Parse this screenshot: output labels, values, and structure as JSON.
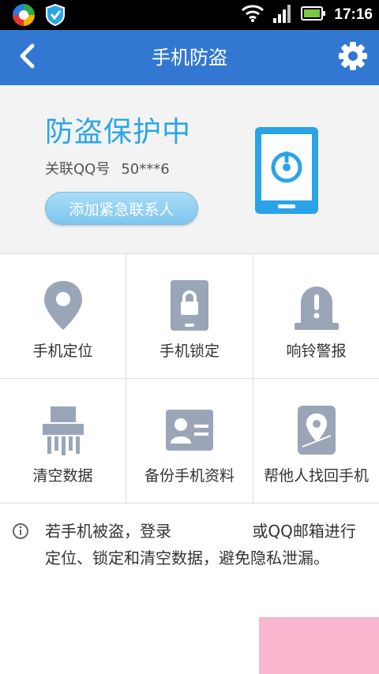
{
  "status_bar": {
    "time": "17:16",
    "icons": [
      "app-logo-icon",
      "shield-icon",
      "wifi-icon",
      "signal-icon",
      "battery-icon"
    ]
  },
  "header": {
    "title": "手机防盗",
    "back_icon": "chevron-left-icon",
    "settings_icon": "gear-icon"
  },
  "protection": {
    "status_title": "防盗保护中",
    "qq_label": "关联QQ号",
    "qq_number": "50***6",
    "add_contact_label": "添加紧急联系人"
  },
  "features": [
    {
      "label": "手机定位",
      "icon": "location-pin-icon"
    },
    {
      "label": "手机锁定",
      "icon": "lock-phone-icon"
    },
    {
      "label": "响铃警报",
      "icon": "alarm-bell-icon"
    },
    {
      "label": "清空数据",
      "icon": "shredder-icon"
    },
    {
      "label": "备份手机资料",
      "icon": "contact-card-icon"
    },
    {
      "label": "帮他人找回手机",
      "icon": "phone-location-icon"
    }
  ],
  "info": {
    "text_before": "若手机被盗，登录",
    "link_text": "",
    "text_after": " 或QQ邮箱进行定位、锁定和清空数据，避免隐私泄漏。"
  },
  "colors": {
    "header_blue": "#3278d2",
    "accent_blue": "#2aa6e6",
    "icon_gray": "#9aa6b8"
  }
}
